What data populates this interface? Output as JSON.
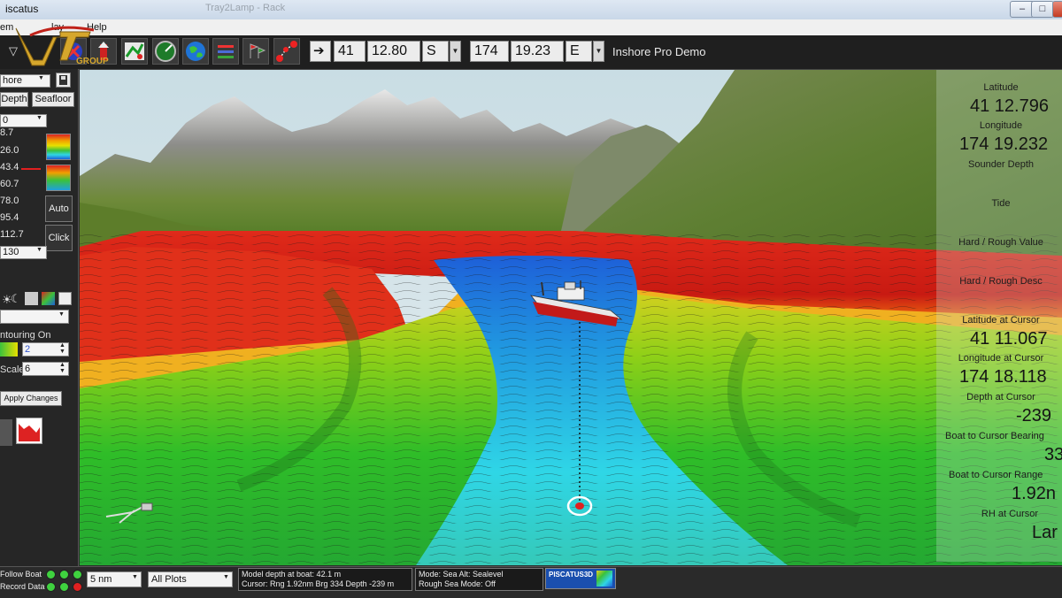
{
  "window": {
    "title": "iscatus",
    "ghost_title": "Tray2Lamp - Rack"
  },
  "menu": [
    "em",
    "lay",
    "Help"
  ],
  "logo": {
    "text": "GROUP",
    "colors": {
      "gold": "#d6a72c",
      "red": "#c0221a"
    }
  },
  "toolbar": {
    "icons": [
      "arrow-down-icon",
      "compass-icon",
      "north-up-icon",
      "chart-icon",
      "gauge-icon",
      "globe-icon",
      "layers-icon",
      "flags-icon",
      "route-icon"
    ],
    "goto_icon": "arrow-right-icon",
    "lat_deg": "41",
    "lat_min": "12.80",
    "lat_hem": "S",
    "lon_deg": "174",
    "lon_min": "19.23",
    "lon_hem": "E",
    "location": "Inshore Pro Demo"
  },
  "left_panel": {
    "preset_value": "hore",
    "depth_button": "Depth",
    "seafloor_button": "Seafloor",
    "top_value": "0",
    "depth_labels": [
      "8.7",
      "26.0",
      "43.4",
      "60.7",
      "78.0",
      "95.4",
      "112.7"
    ],
    "bottom_value": "130",
    "auto_button": "Auto",
    "click_button": "Click",
    "contouring_label": "ntouring On",
    "contour_value": "2",
    "scale_label": "Scale",
    "scale_value": "6",
    "apply_button": "Apply Changes"
  },
  "info_panel": {
    "latitude_label": "Latitude",
    "latitude_value": "41 12.796",
    "longitude_label": "Longitude",
    "longitude_value": "174 19.232",
    "sounder_label": "Sounder Depth",
    "tide_label": "Tide",
    "hard_rough_value_label": "Hard / Rough Value",
    "hard_rough_desc_label": "Hard / Rough Desc",
    "lat_cursor_label": "Latitude at Cursor",
    "lat_cursor_value": "41 11.067",
    "lon_cursor_label": "Longitude at Cursor",
    "lon_cursor_value": "174 18.118",
    "depth_cursor_label": "Depth at Cursor",
    "depth_cursor_value": "-239",
    "bearing_label": "Boat to Cursor Bearing",
    "bearing_value": "33",
    "range_label": "Boat to Cursor Range",
    "range_value": "1.92n",
    "rh_label": "RH at Cursor",
    "rh_value": "Lar"
  },
  "status": {
    "follow_boat": "Follow Boat",
    "record_data": "Record Data",
    "range_value": "5 nm",
    "plots_value": "All Plots",
    "model_depth": "Model depth at boat: 42.1 m",
    "cursor_info": "Cursor: Rng 1.92nm Brg 334 Depth -239 m",
    "mode_info": "Mode: Sea  Alt: Sealevel",
    "rough_info": "Rough Sea Mode: Off",
    "brand": "PISCATUS3D",
    "led_colors": {
      "green": "#3fd23f",
      "red": "#e02020"
    }
  },
  "colors": {
    "sky": "#d7e6ea",
    "terrain_red": "#d42015",
    "terrain_green": "#3fbe2a",
    "water_blue": "#1e5fd8",
    "water_cyan": "#2fd6e6"
  }
}
